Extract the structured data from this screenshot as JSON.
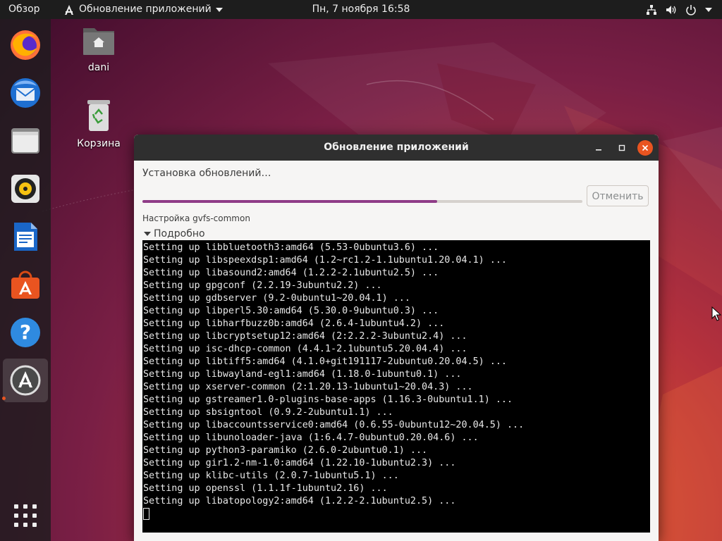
{
  "topbar": {
    "overview_label": "Обзор",
    "app_menu_label": "Обновление приложений",
    "clock": "Пн, 7 ноября  16:58",
    "tray_icons": [
      "network-icon",
      "volume-icon",
      "power-icon",
      "chevron-down-icon"
    ]
  },
  "dock": {
    "items": [
      {
        "name": "firefox",
        "icon": "firefox-icon"
      },
      {
        "name": "thunderbird",
        "icon": "thunderbird-icon"
      },
      {
        "name": "files",
        "icon": "files-icon"
      },
      {
        "name": "rhythmbox",
        "icon": "rhythmbox-icon"
      },
      {
        "name": "libreoffice-writer",
        "icon": "writer-icon"
      },
      {
        "name": "ubuntu-software",
        "icon": "software-icon"
      },
      {
        "name": "help",
        "icon": "help-icon"
      },
      {
        "name": "software-updater",
        "icon": "updater-icon",
        "active": true
      }
    ],
    "show_apps_icon": "app-grid-icon"
  },
  "desktop": {
    "icons": [
      {
        "label": "dani",
        "icon": "home-folder-icon"
      },
      {
        "label": "Корзина",
        "icon": "trash-icon"
      }
    ]
  },
  "window": {
    "title": "Обновление приложений",
    "status_title": "Установка обновлений…",
    "progress_percent": 67,
    "cancel_label": "Отменить",
    "current_action": "Настройка gvfs-common",
    "details_label": "Подробно",
    "colors": {
      "accent": "#e95420",
      "progress": "#8f3c87",
      "terminal_bg": "#000000"
    },
    "terminal_lines": [
      "Setting up libbluetooth3:amd64 (5.53-0ubuntu3.6) ...",
      "Setting up libspeexdsp1:amd64 (1.2~rc1.2-1.1ubuntu1.20.04.1) ...",
      "Setting up libasound2:amd64 (1.2.2-2.1ubuntu2.5) ...",
      "Setting up gpgconf (2.2.19-3ubuntu2.2) ...",
      "Setting up gdbserver (9.2-0ubuntu1~20.04.1) ...",
      "Setting up libperl5.30:amd64 (5.30.0-9ubuntu0.3) ...",
      "Setting up libharfbuzz0b:amd64 (2.6.4-1ubuntu4.2) ...",
      "Setting up libcryptsetup12:amd64 (2:2.2.2-3ubuntu2.4) ...",
      "Setting up isc-dhcp-common (4.4.1-2.1ubuntu5.20.04.4) ...",
      "Setting up libtiff5:amd64 (4.1.0+git191117-2ubuntu0.20.04.5) ...",
      "Setting up libwayland-egl1:amd64 (1.18.0-1ubuntu0.1) ...",
      "Setting up xserver-common (2:1.20.13-1ubuntu1~20.04.3) ...",
      "Setting up gstreamer1.0-plugins-base-apps (1.16.3-0ubuntu1.1) ...",
      "Setting up sbsigntool (0.9.2-2ubuntu1.1) ...",
      "Setting up libaccountsservice0:amd64 (0.6.55-0ubuntu12~20.04.5) ...",
      "Setting up libunoloader-java (1:6.4.7-0ubuntu0.20.04.6) ...",
      "Setting up python3-paramiko (2.6.0-2ubuntu0.1) ...",
      "Setting up gir1.2-nm-1.0:amd64 (1.22.10-1ubuntu2.3) ...",
      "Setting up klibc-utils (2.0.7-1ubuntu5.1) ...",
      "Setting up openssl (1.1.1f-1ubuntu2.16) ...",
      "Setting up libatopology2:amd64 (1.2.2-2.1ubuntu2.5) ..."
    ]
  }
}
